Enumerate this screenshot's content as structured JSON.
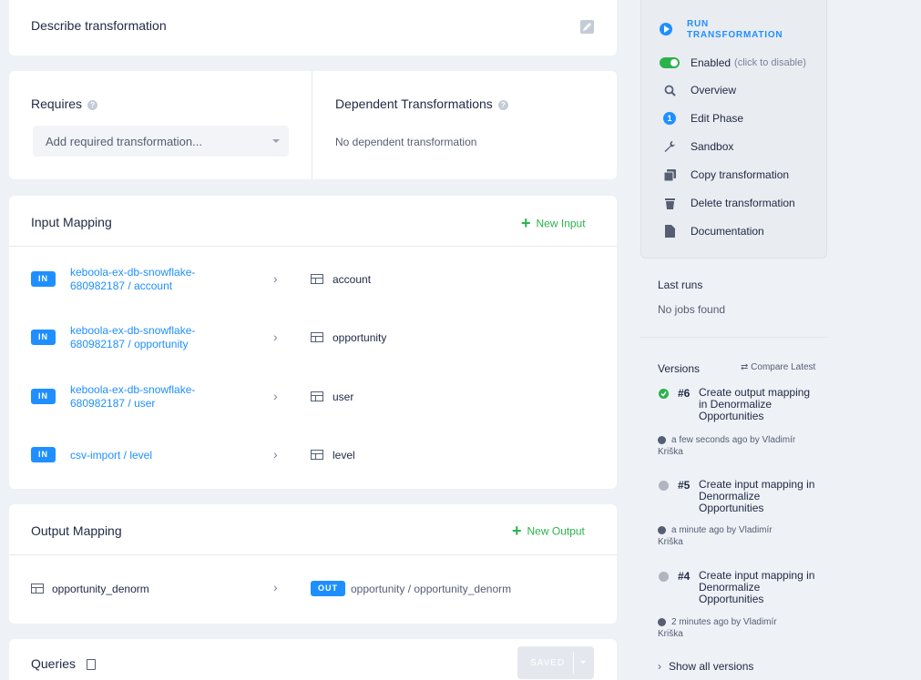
{
  "describe": {
    "title": "Describe transformation"
  },
  "requires": {
    "title": "Requires",
    "placeholder": "Add required transformation..."
  },
  "dependent": {
    "title": "Dependent Transformations",
    "empty": "No dependent transformation"
  },
  "input_mapping": {
    "title": "Input Mapping",
    "new_label": "New Input",
    "rows": [
      {
        "badge": "IN",
        "source_line1": "keboola-ex-db-snowflake-",
        "source_line2": "680982187 / account",
        "target": "account"
      },
      {
        "badge": "IN",
        "source_line1": "keboola-ex-db-snowflake-",
        "source_line2": "680982187 / opportunity",
        "target": "opportunity"
      },
      {
        "badge": "IN",
        "source_line1": "keboola-ex-db-snowflake-",
        "source_line2": "680982187 / user",
        "target": "user"
      },
      {
        "badge": "IN",
        "source_line1": "csv-import / level",
        "source_line2": "",
        "target": "level"
      }
    ]
  },
  "output_mapping": {
    "title": "Output Mapping",
    "new_label": "New Output",
    "rows": [
      {
        "source": "opportunity_denorm",
        "badge": "OUT",
        "target": "opportunity / opportunity_denorm"
      }
    ]
  },
  "queries": {
    "title": "Queries",
    "saved_label": "SAVED"
  },
  "sidebar": {
    "run_label_1": "RUN",
    "run_label_2": "TRANSFORMATION",
    "enabled_label": "Enabled",
    "enabled_hint": "(click to disable)",
    "items": [
      {
        "label": "Overview",
        "icon": "search-icon"
      },
      {
        "label": "Edit Phase",
        "icon": "phase-number-icon",
        "phase": "1"
      },
      {
        "label": "Sandbox",
        "icon": "wrench-icon"
      },
      {
        "label": "Copy transformation",
        "icon": "copy-icon"
      },
      {
        "label": "Delete transformation",
        "icon": "trash-icon"
      },
      {
        "label": "Documentation",
        "icon": "document-icon"
      }
    ],
    "accent": "#1f8fff",
    "toggle_color": "#2bb24c"
  },
  "last_runs": {
    "title": "Last runs",
    "empty": "No jobs found"
  },
  "versions": {
    "title": "Versions",
    "compare_label": "Compare Latest",
    "items": [
      {
        "number": "#6",
        "line1": "Create output mapping",
        "line2": "in Denormalize",
        "line3": "Opportunities",
        "time1": "a few seconds ago by Vladimír",
        "time2": "Kriška",
        "status": "#2bb24c"
      },
      {
        "number": "#5",
        "line1": "Create input mapping in",
        "line2": "Denormalize",
        "line3": "Opportunities",
        "time1": "a minute ago by Vladimír",
        "time2": "Kriška",
        "status": "#b0b5c0"
      },
      {
        "number": "#4",
        "line1": "Create input mapping in",
        "line2": "Denormalize",
        "line3": "Opportunities",
        "time1": "2 minutes ago by Vladimír",
        "time2": "Kriška",
        "status": "#b0b5c0"
      }
    ],
    "show_all": "Show all versions"
  }
}
